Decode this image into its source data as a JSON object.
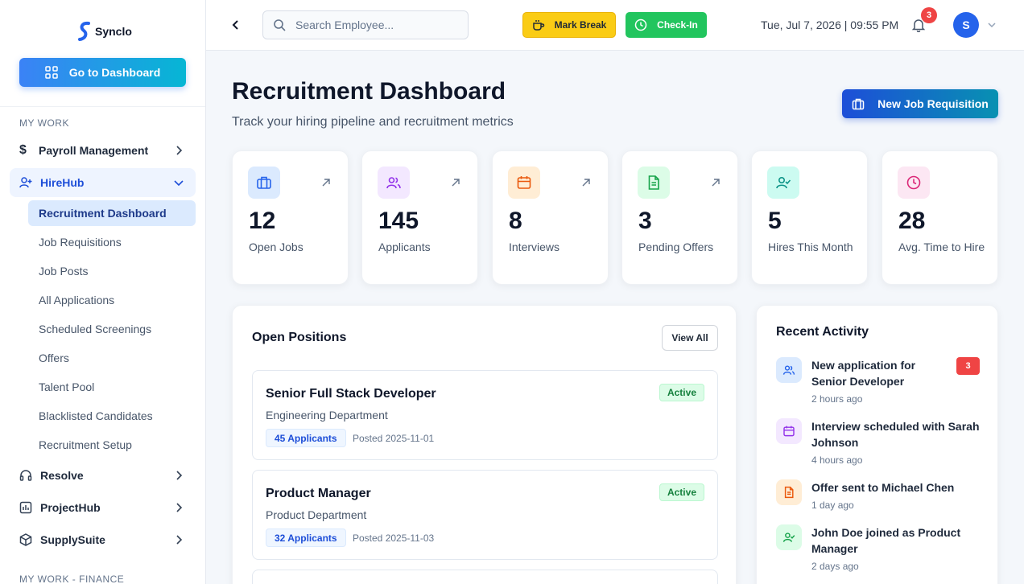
{
  "app": {
    "name": "Synclo"
  },
  "sidebar": {
    "dashboard_button": "Go to Dashboard",
    "section_my_work": "MY WORK",
    "section_finance": "MY WORK - FINANCE",
    "items": [
      {
        "label": "Payroll Management",
        "icon": "dollar-icon"
      },
      {
        "label": "HireHub",
        "icon": "user-plus-icon",
        "expanded": true
      },
      {
        "label": "Resolve",
        "icon": "headphones-icon"
      },
      {
        "label": "ProjectHub",
        "icon": "chart-icon"
      },
      {
        "label": "SupplySuite",
        "icon": "box-icon"
      }
    ],
    "sub_items": [
      "Recruitment Dashboard",
      "Job Requisitions",
      "Job Posts",
      "All Applications",
      "Scheduled Screenings",
      "Offers",
      "Talent Pool",
      "Blacklisted Candidates",
      "Recruitment Setup"
    ]
  },
  "header": {
    "search_placeholder": "Search Employee...",
    "mark_break": "Mark Break",
    "check_in": "Check-In",
    "datetime": "Tue, Jul 7, 2026 | 09:55 PM",
    "notifications": "3",
    "avatar_initial": "S"
  },
  "page": {
    "title": "Recruitment Dashboard",
    "subtitle": "Track your hiring pipeline and recruitment metrics",
    "new_button": "New Job Requisition"
  },
  "stats": [
    {
      "value": "12",
      "label": "Open Jobs",
      "icon": "briefcase-icon",
      "color": "#2563eb"
    },
    {
      "value": "145",
      "label": "Applicants",
      "icon": "users-icon",
      "color": "#9333ea"
    },
    {
      "value": "8",
      "label": "Interviews",
      "icon": "calendar-icon",
      "color": "#ea580c"
    },
    {
      "value": "3",
      "label": "Pending Offers",
      "icon": "document-icon",
      "color": "#16a34a"
    },
    {
      "value": "5",
      "label": "Hires This Month",
      "icon": "user-check-icon",
      "color": "#0d9488"
    },
    {
      "value": "28",
      "label": "Avg. Time to Hire",
      "icon": "clock-icon",
      "color": "#db2777"
    }
  ],
  "open_positions": {
    "title": "Open Positions",
    "view_all": "View All",
    "jobs": [
      {
        "title": "Senior Full Stack Developer",
        "department": "Engineering Department",
        "applicants": "45 Applicants",
        "posted": "Posted 2025-11-01",
        "status": "Active"
      },
      {
        "title": "Product Manager",
        "department": "Product Department",
        "applicants": "32 Applicants",
        "posted": "Posted 2025-11-03",
        "status": "Active"
      }
    ]
  },
  "recent_activity": {
    "title": "Recent Activity",
    "items": [
      {
        "text": "New application for Senior Developer",
        "time": "2 hours ago",
        "badge": "3",
        "icon": "users-icon"
      },
      {
        "text": "Interview scheduled with Sarah Johnson",
        "time": "4 hours ago",
        "icon": "calendar-icon"
      },
      {
        "text": "Offer sent to Michael Chen",
        "time": "1 day ago",
        "icon": "document-icon"
      },
      {
        "text": "John Doe joined as Product Manager",
        "time": "2 days ago",
        "icon": "user-check-icon"
      }
    ]
  }
}
